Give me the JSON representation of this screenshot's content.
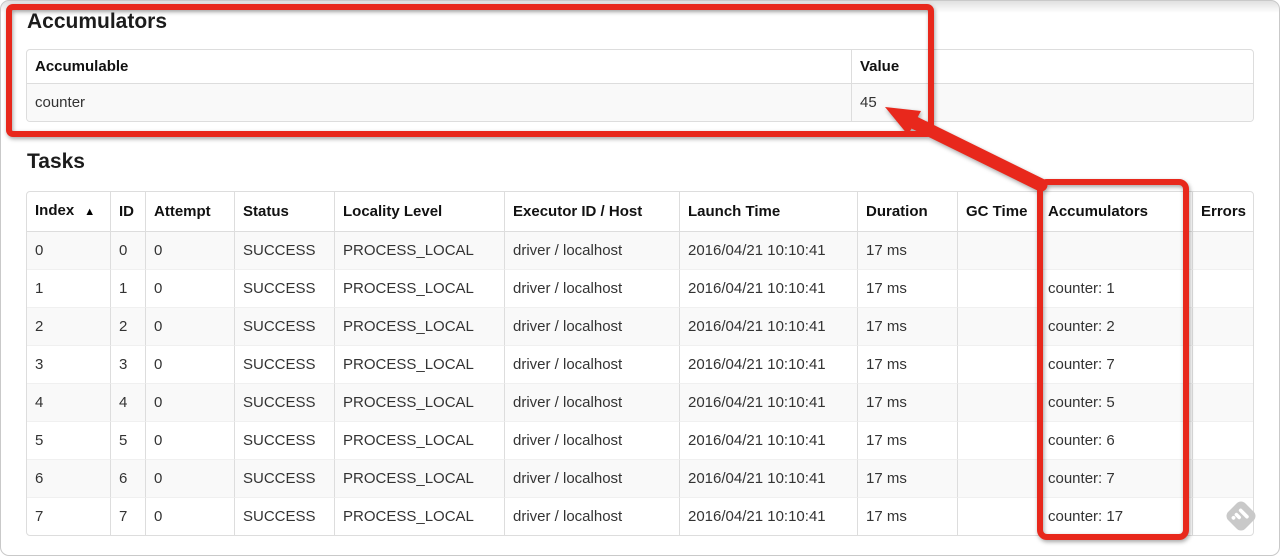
{
  "accumulators_section": {
    "title": "Accumulators",
    "table": {
      "headers": [
        "Accumulable",
        "Value"
      ],
      "rows": [
        [
          "counter",
          "45"
        ]
      ]
    }
  },
  "tasks_section": {
    "title": "Tasks",
    "table": {
      "headers": [
        "Index",
        "ID",
        "Attempt",
        "Status",
        "Locality Level",
        "Executor ID / Host",
        "Launch Time",
        "Duration",
        "GC Time",
        "Accumulators",
        "Errors"
      ],
      "sorted_column": 0,
      "sort_icon": "▲",
      "rows": [
        [
          "0",
          "0",
          "0",
          "SUCCESS",
          "PROCESS_LOCAL",
          "driver / localhost",
          "2016/04/21 10:10:41",
          "17 ms",
          "",
          "",
          ""
        ],
        [
          "1",
          "1",
          "0",
          "SUCCESS",
          "PROCESS_LOCAL",
          "driver / localhost",
          "2016/04/21 10:10:41",
          "17 ms",
          "",
          "counter: 1",
          ""
        ],
        [
          "2",
          "2",
          "0",
          "SUCCESS",
          "PROCESS_LOCAL",
          "driver / localhost",
          "2016/04/21 10:10:41",
          "17 ms",
          "",
          "counter: 2",
          ""
        ],
        [
          "3",
          "3",
          "0",
          "SUCCESS",
          "PROCESS_LOCAL",
          "driver / localhost",
          "2016/04/21 10:10:41",
          "17 ms",
          "",
          "counter: 7",
          ""
        ],
        [
          "4",
          "4",
          "0",
          "SUCCESS",
          "PROCESS_LOCAL",
          "driver / localhost",
          "2016/04/21 10:10:41",
          "17 ms",
          "",
          "counter: 5",
          ""
        ],
        [
          "5",
          "5",
          "0",
          "SUCCESS",
          "PROCESS_LOCAL",
          "driver / localhost",
          "2016/04/21 10:10:41",
          "17 ms",
          "",
          "counter: 6",
          ""
        ],
        [
          "6",
          "6",
          "0",
          "SUCCESS",
          "PROCESS_LOCAL",
          "driver / localhost",
          "2016/04/21 10:10:41",
          "17 ms",
          "",
          "counter: 7",
          ""
        ],
        [
          "7",
          "7",
          "0",
          "SUCCESS",
          "PROCESS_LOCAL",
          "driver / localhost",
          "2016/04/21 10:10:41",
          "17 ms",
          "",
          "counter: 17",
          ""
        ]
      ]
    }
  },
  "annotations": {
    "highlight_color": "#e8281c",
    "accumulators_box": "highlight around Accumulators summary table",
    "column_box": "highlight around Accumulators task column",
    "arrow": "arrow from Accumulators column to total value 45"
  },
  "watermark": {
    "name": "skitch-watermark",
    "color": "#c9c9c9"
  }
}
